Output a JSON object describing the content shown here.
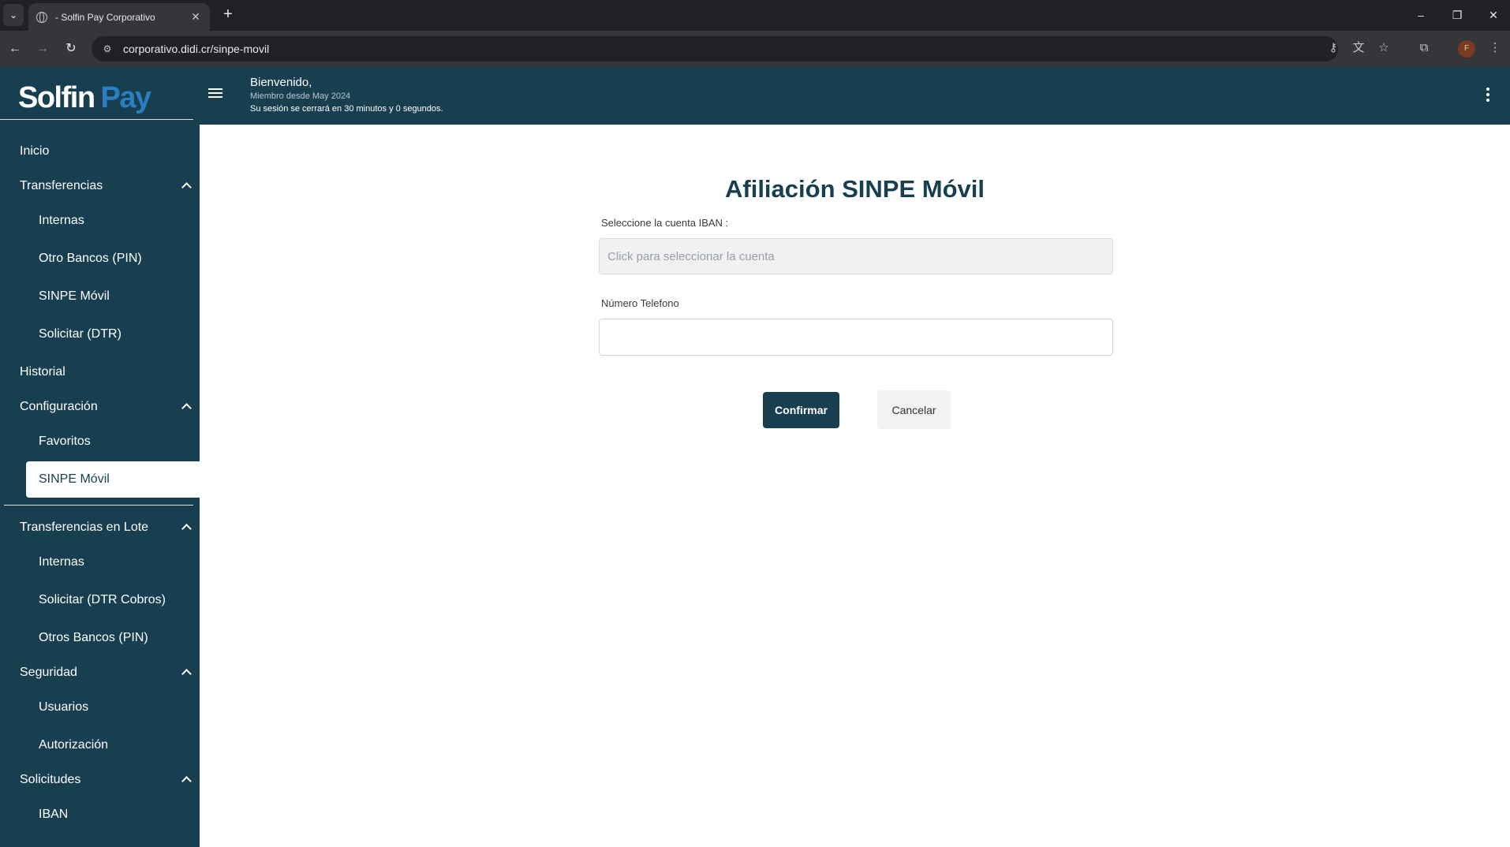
{
  "browser": {
    "tab_title": "- Solfin Pay Corporativo",
    "tab_close": "✕",
    "new_tab": "+",
    "url": "corporativo.didi.cr/sinpe-movil",
    "profile_initial": "F",
    "window_controls": {
      "minimize": "–",
      "restore": "❐",
      "close": "✕"
    }
  },
  "header": {
    "logo_part1": "Solfin",
    "logo_part2": "Pay",
    "welcome": "Bienvenido,",
    "member_since": "Miembro desde May 2024",
    "session_notice": "Su sesión se cerrará en 30 minutos y 0 segundos."
  },
  "sidebar": {
    "items": [
      {
        "label": "Inicio",
        "level": "top",
        "expanded": null
      },
      {
        "label": "Transferencias",
        "level": "top",
        "expanded": true
      },
      {
        "label": "Internas",
        "level": "sub"
      },
      {
        "label": "Otro Bancos (PIN)",
        "level": "sub"
      },
      {
        "label": "SINPE Móvil",
        "level": "sub"
      },
      {
        "label": "Solicitar (DTR)",
        "level": "sub"
      },
      {
        "label": "Historial",
        "level": "top",
        "expanded": null
      },
      {
        "label": "Configuración",
        "level": "top",
        "expanded": true
      },
      {
        "label": "Favoritos",
        "level": "sub"
      },
      {
        "label": "SINPE Móvil",
        "level": "sub",
        "active": true
      },
      {
        "label": "Transferencias en Lote",
        "level": "top",
        "expanded": true
      },
      {
        "label": "Internas",
        "level": "sub"
      },
      {
        "label": "Solicitar (DTR Cobros)",
        "level": "sub"
      },
      {
        "label": "Otros Bancos (PIN)",
        "level": "sub"
      },
      {
        "label": "Seguridad",
        "level": "top",
        "expanded": true
      },
      {
        "label": "Usuarios",
        "level": "sub"
      },
      {
        "label": "Autorización",
        "level": "sub"
      },
      {
        "label": "Solicitudes",
        "level": "top",
        "expanded": true
      },
      {
        "label": "IBAN",
        "level": "sub"
      }
    ]
  },
  "main": {
    "title": "Afiliación SINPE Móvil",
    "iban_label": "Seleccione la cuenta IBAN :",
    "iban_placeholder": "Click para seleccionar la cuenta",
    "phone_label": "Número Telefono",
    "phone_value": "",
    "confirm_label": "Confirmar",
    "cancel_label": "Cancelar"
  },
  "colors": {
    "brand_dark": "#173f50",
    "brand_accent": "#2a7fc0"
  }
}
